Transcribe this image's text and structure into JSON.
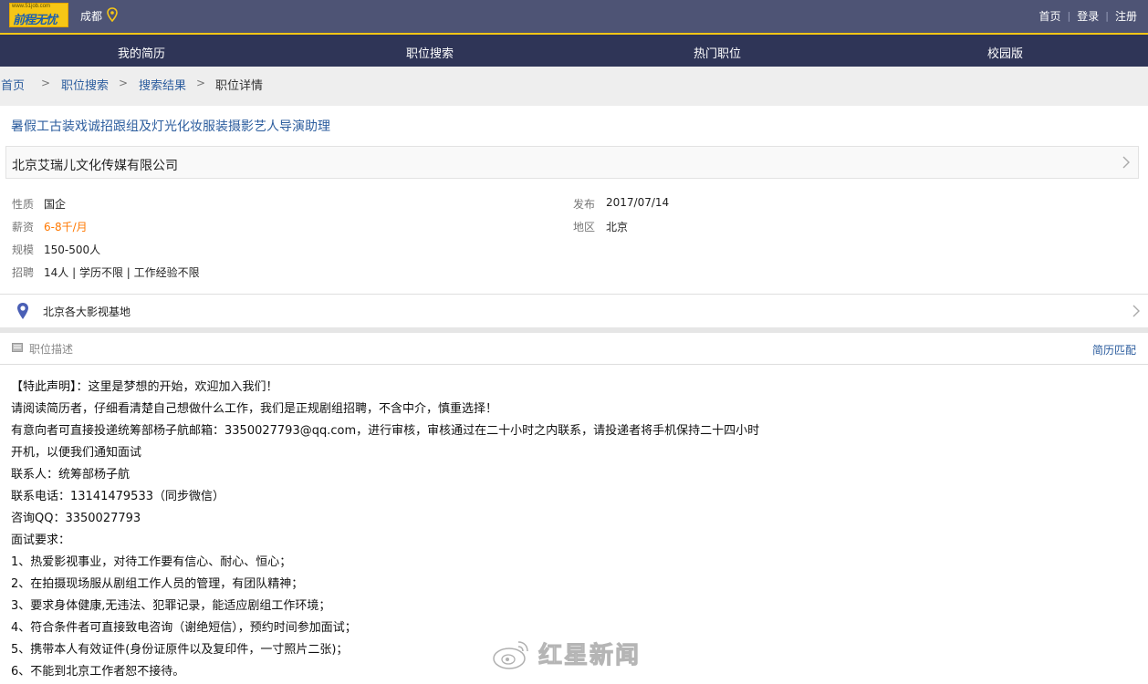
{
  "header": {
    "logo_top": "www.51job.com",
    "logo_text": "前程无忧",
    "city": "成都",
    "links": [
      "首页",
      "登录",
      "注册"
    ]
  },
  "nav": {
    "items": [
      "我的简历",
      "职位搜索",
      "热门职位",
      "校园版"
    ]
  },
  "breadcrumb": [
    "首页",
    "职位搜索",
    "搜索结果",
    "职位详情"
  ],
  "job": {
    "title": "暑假工古装戏诚招跟组及灯光化妆服装摄影艺人导演助理",
    "company": "北京艾瑞儿文化传媒有限公司",
    "info": {
      "nature_label": "性质",
      "nature": "国企",
      "salary_label": "薪资",
      "salary": "6-8千/月",
      "scale_label": "规模",
      "scale": "150-500人",
      "recruit_label": "招聘",
      "recruit": "14人 | 学历不限 | 工作经验不限",
      "publish_label": "发布",
      "publish": "2017/07/14",
      "area_label": "地区",
      "area": "北京"
    },
    "location": "北京各大影视基地"
  },
  "description": {
    "label": "职位描述",
    "match_link": "简历匹配",
    "lines": [
      "【特此声明】：这里是梦想的开始，欢迎加入我们！",
      "请阅读简历者，仔细看清楚自己想做什么工作，我们是正规剧组招聘，不含中介，慎重选择！",
      "有意向者可直接投递统筹部杨子航邮箱：3350027793@qq.com，进行审核，审核通过在二十小时之内联系，请投递者将手机保持二十四小时",
      "开机，以便我们通知面试",
      "联系人：统筹部杨子航",
      "联系电话：13141479533（同步微信）",
      "咨询QQ：3350027793",
      "面试要求：",
      "1、热爱影视事业，对待工作要有信心、耐心、恒心；",
      "2、在拍摄现场服从剧组工作人员的管理，有团队精神；",
      "3、要求身体健康,无违法、犯罪记录，能适应剧组工作环境；",
      "4、符合条件者可直接致电咨询（谢绝短信），预约时间参加面试；",
      "5、携带本人有效证件(身份证原件以及复印件，一寸照片二张)；",
      "6、不能到北京工作者恕不接待。"
    ]
  },
  "watermark": {
    "text": "红星新闻"
  },
  "colors": {
    "topbar": "#4e5475",
    "nav": "#2f3557",
    "accent": "#f6c616",
    "link": "#2c5d9e",
    "salary": "#ff7800"
  },
  "icons": [
    "location-pin-icon",
    "chevron-right-icon",
    "description-icon",
    "weibo-icon"
  ]
}
